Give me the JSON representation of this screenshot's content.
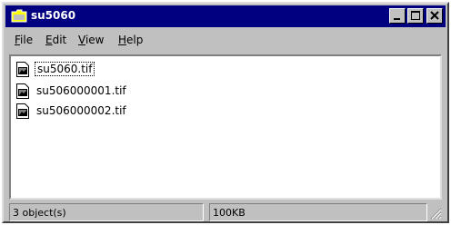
{
  "window": {
    "title": "su5060"
  },
  "menu": [
    {
      "label": "File"
    },
    {
      "label": "Edit"
    },
    {
      "label": "View"
    },
    {
      "label": "Help"
    }
  ],
  "files": [
    {
      "name": "su5060.tif",
      "icon": "tif-file-icon",
      "selected": true
    },
    {
      "name": "su506000001.tif",
      "icon": "tif-file-icon",
      "selected": false
    },
    {
      "name": "su506000002.tif",
      "icon": "tif-file-icon",
      "selected": false
    }
  ],
  "status": {
    "objects": "3 object(s)",
    "size": "100KB"
  },
  "colors": {
    "titlebar": "#000080",
    "face": "#c0c0c0"
  }
}
